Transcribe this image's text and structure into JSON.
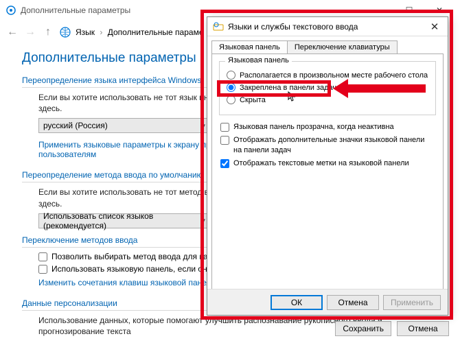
{
  "window": {
    "title": "Дополнительные параметры",
    "breadcrumb": {
      "root": "Язык",
      "current": "Дополнительные параме"
    }
  },
  "page": {
    "heading": "Дополнительные параметры",
    "sec1": {
      "title": "Переопределение языка интерфейса Windows",
      "para": "Если вы хотите использовать не тот язык интерфейса, который находится наверху списка, выберите его здесь.",
      "dropdown": "русский (Россия)",
      "link": "Применить языковые параметры к экрану приветствия, системным учетным записям и новым пользователям"
    },
    "sec2": {
      "title": "Переопределение метода ввода по умолчанию",
      "para": "Если вы хотите использовать не тот метод ввода, который находится наверху списка, выберите его здесь.",
      "dropdown": "Использовать список языков (рекомендуется)"
    },
    "sec3": {
      "title": "Переключение методов ввода",
      "chk1": "Позволить выбирать метод ввода для каждого приложения",
      "chk2": "Использовать языковую панель, если она доступна",
      "link": "Изменить сочетания клавиш языковой панели"
    },
    "sec4": {
      "title": "Данные персонализации",
      "para": "Использование данных, которые помогают улучшить распознавание рукописного ввода и прогнозирование текста"
    },
    "buttons": {
      "save": "Сохранить",
      "cancel": "Отмена"
    }
  },
  "dialog": {
    "title": "Языки и службы текстового ввода",
    "tab1": "Языковая панель",
    "tab2": "Переключение клавиатуры",
    "group_legend": "Языковая панель",
    "radio1": "Располагается в произвольном месте рабочего стола",
    "radio2": "Закреплена в панели задач",
    "radio3": "Скрыта",
    "chk1": "Языковая панель прозрачна, когда неактивна",
    "chk2": "Отображать дополнительные значки языковой панели на панели задач",
    "chk3": "Отображать текстовые метки на языковой панели",
    "buttons": {
      "ok": "ОК",
      "cancel": "Отмена",
      "apply": "Применить"
    }
  },
  "icons": {
    "gear": "gear-icon",
    "lang": "globe-icon"
  }
}
